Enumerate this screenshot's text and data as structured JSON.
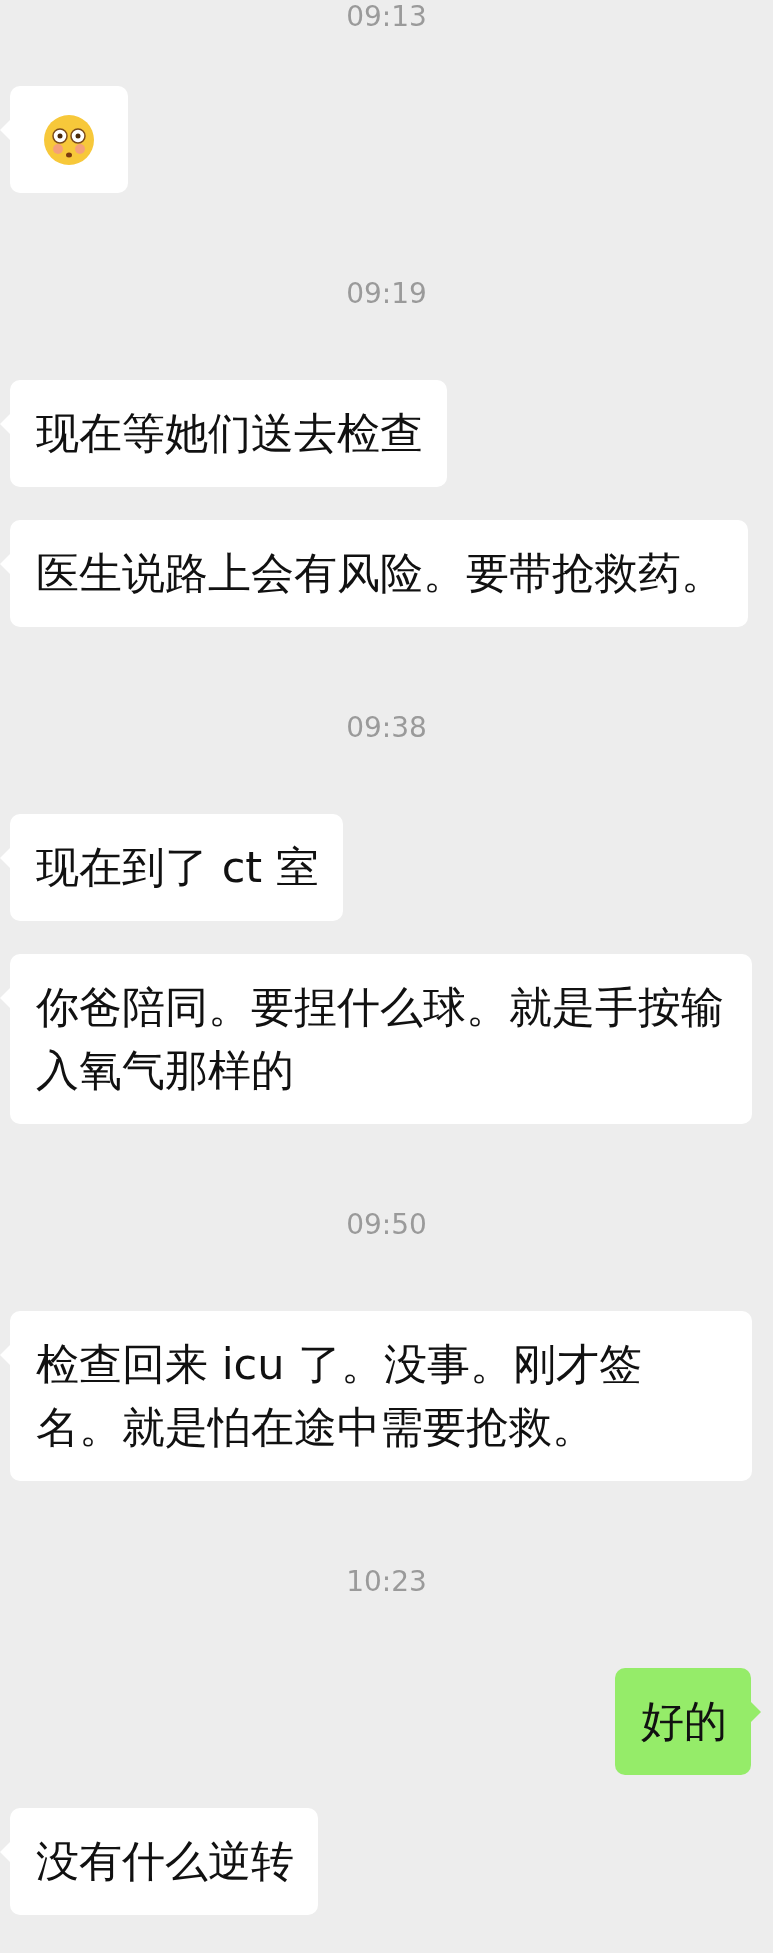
{
  "messages": [
    {
      "kind": "time",
      "text": "09:13"
    },
    {
      "kind": "sticker"
    },
    {
      "kind": "time",
      "text": "09:19"
    },
    {
      "kind": "received",
      "text": "现在等她们送去检查"
    },
    {
      "kind": "received",
      "text": "医生说路上会有风险。要带抢救药。"
    },
    {
      "kind": "time",
      "text": "09:38"
    },
    {
      "kind": "received",
      "text": "现在到了 ct 室"
    },
    {
      "kind": "received",
      "text": "你爸陪同。要捏什么球。就是手按输入氧气那样的"
    },
    {
      "kind": "time",
      "text": "09:50"
    },
    {
      "kind": "received",
      "text": "检查回来 icu 了。没事。刚才签名。就是怕在途中需要抢救。"
    },
    {
      "kind": "time",
      "text": "10:23"
    },
    {
      "kind": "sent",
      "text": "好的"
    },
    {
      "kind": "received",
      "text": "没有什么逆转"
    }
  ]
}
